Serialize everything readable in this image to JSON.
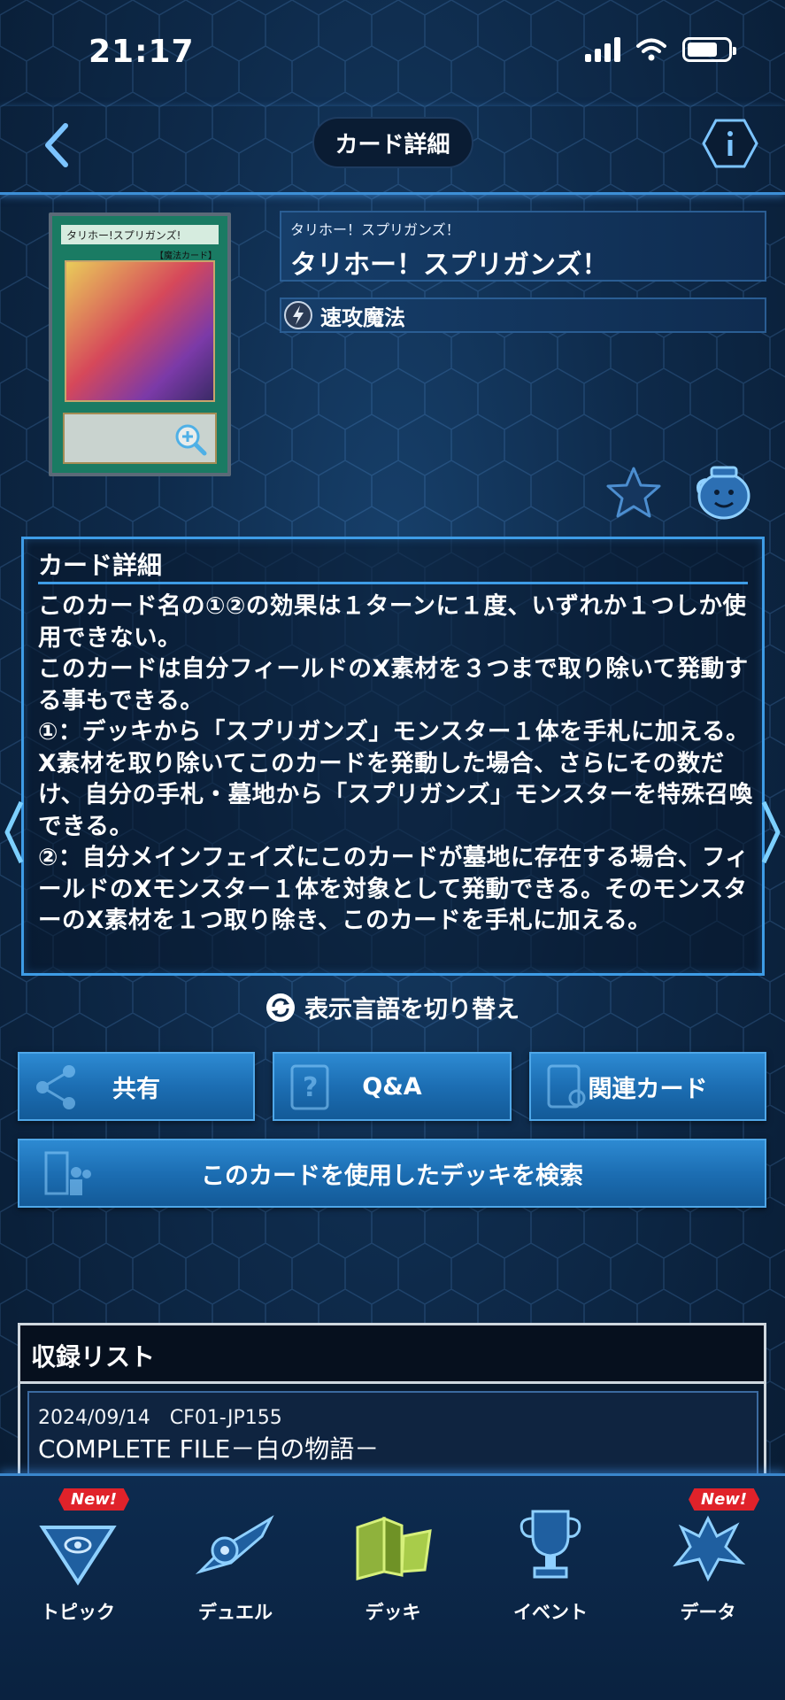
{
  "status": {
    "time": "21:17"
  },
  "header": {
    "title": "カード詳細"
  },
  "card": {
    "image_name": "タリホー!スプリガンズ!",
    "image_type_label": "【魔法カード】",
    "subname": "タリホー！スプリガンズ！",
    "name": "タリホー！スプリガンズ！",
    "type": "速攻魔法"
  },
  "description": {
    "title": "カード詳細",
    "text": "このカード名の①②の効果は１ターンに１度、いずれか１つしか使用できない。\nこのカードは自分フィールドのX素材を３つまで取り除いて発動する事もできる。\n①：デッキから「スプリガンズ」モンスター１体を手札に加える。X素材を取り除いてこのカードを発動した場合、さらにその数だけ、自分の手札・墓地から「スプリガンズ」モンスターを特殊召喚できる。\n②：自分メインフェイズにこのカードが墓地に存在する場合、フィールドのXモンスター１体を対象として発動できる。そのモンスターのX素材を１つ取り除き、このカードを手札に加える。"
  },
  "lang_switch": "表示言語を切り替え",
  "buttons": {
    "share": "共有",
    "qa": "Q&A",
    "related": "関連カード",
    "search_decks": "このカードを使用したデッキを検索"
  },
  "release_list": {
    "title": "収録リスト",
    "items": [
      {
        "date_code": "2024/09/14　CF01-JP155",
        "pack": "COMPLETE FILE－白の物語－"
      }
    ]
  },
  "tabbar": {
    "badge": "New!",
    "items": [
      {
        "label": "トピック",
        "icon": "millennium-puzzle-icon",
        "new": true
      },
      {
        "label": "デュエル",
        "icon": "duel-disk-icon",
        "new": false
      },
      {
        "label": "デッキ",
        "icon": "deck-cards-icon",
        "new": false
      },
      {
        "label": "イベント",
        "icon": "trophy-icon",
        "new": false
      },
      {
        "label": "データ",
        "icon": "dragon-data-icon",
        "new": true
      }
    ]
  },
  "colors": {
    "accent": "#3e9ce6",
    "button": "#1c6eb3",
    "badge": "#e0222a"
  }
}
